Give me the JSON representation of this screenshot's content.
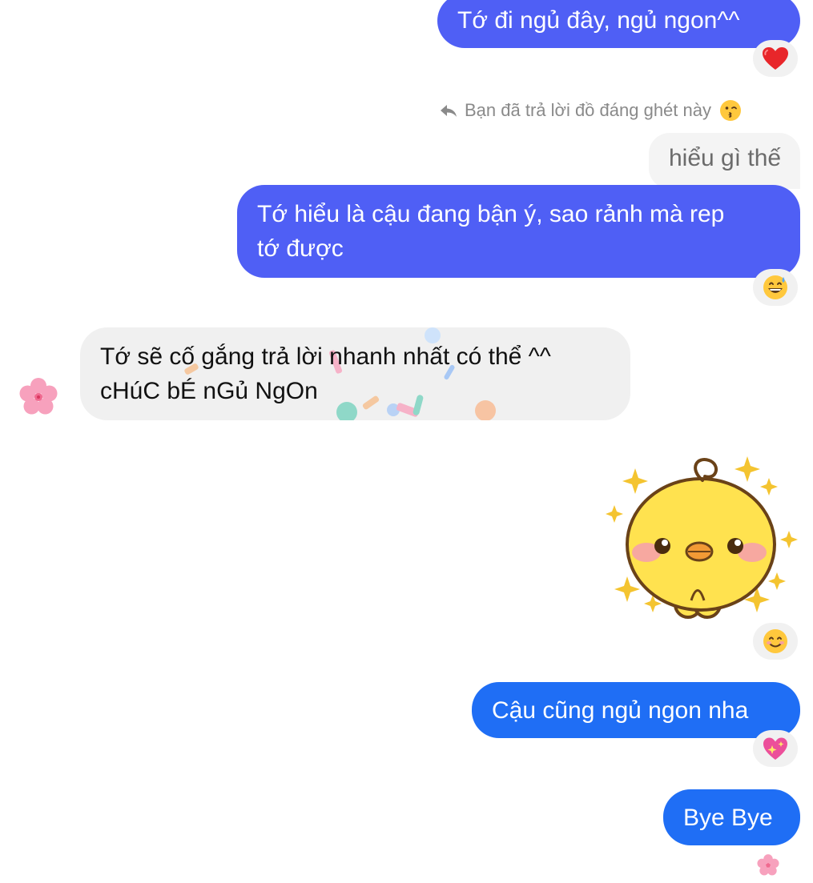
{
  "messages": {
    "m1": "Tớ đi ngủ đây, ngủ ngon^^",
    "reply_label": "Bạn đã trả lời đồ đáng ghét này",
    "quoted": "hiểu gì thế",
    "m2_line1": "Tớ hiểu là cậu đang bận ý, sao rảnh mà rep",
    "m2_line2": "tớ được",
    "m3_line1": "Tớ sẽ cố gắng trả lời nhanh nhất có thể ^^",
    "m3_line2": "cHúC bÉ nGủ NgOn",
    "m4": "Cậu cũng ngủ ngon nha",
    "m5": "Bye Bye"
  },
  "icons": {
    "reaction_1": "red-heart-icon",
    "reply_emoji": "kissing-face-icon",
    "reaction_2": "grinning-sweat-face-icon",
    "contact_avatar": "cherry-blossom-icon",
    "sticker": "yellow-chick-sticker",
    "reaction_3": "smiling-face-icon",
    "reaction_4": "sparkling-heart-icon",
    "seen_indicator": "cherry-blossom-icon"
  },
  "colors": {
    "outgoing_purple": "#4f5ff5",
    "outgoing_blue": "#1f6ef5",
    "incoming_gray": "#f0f0f0"
  }
}
